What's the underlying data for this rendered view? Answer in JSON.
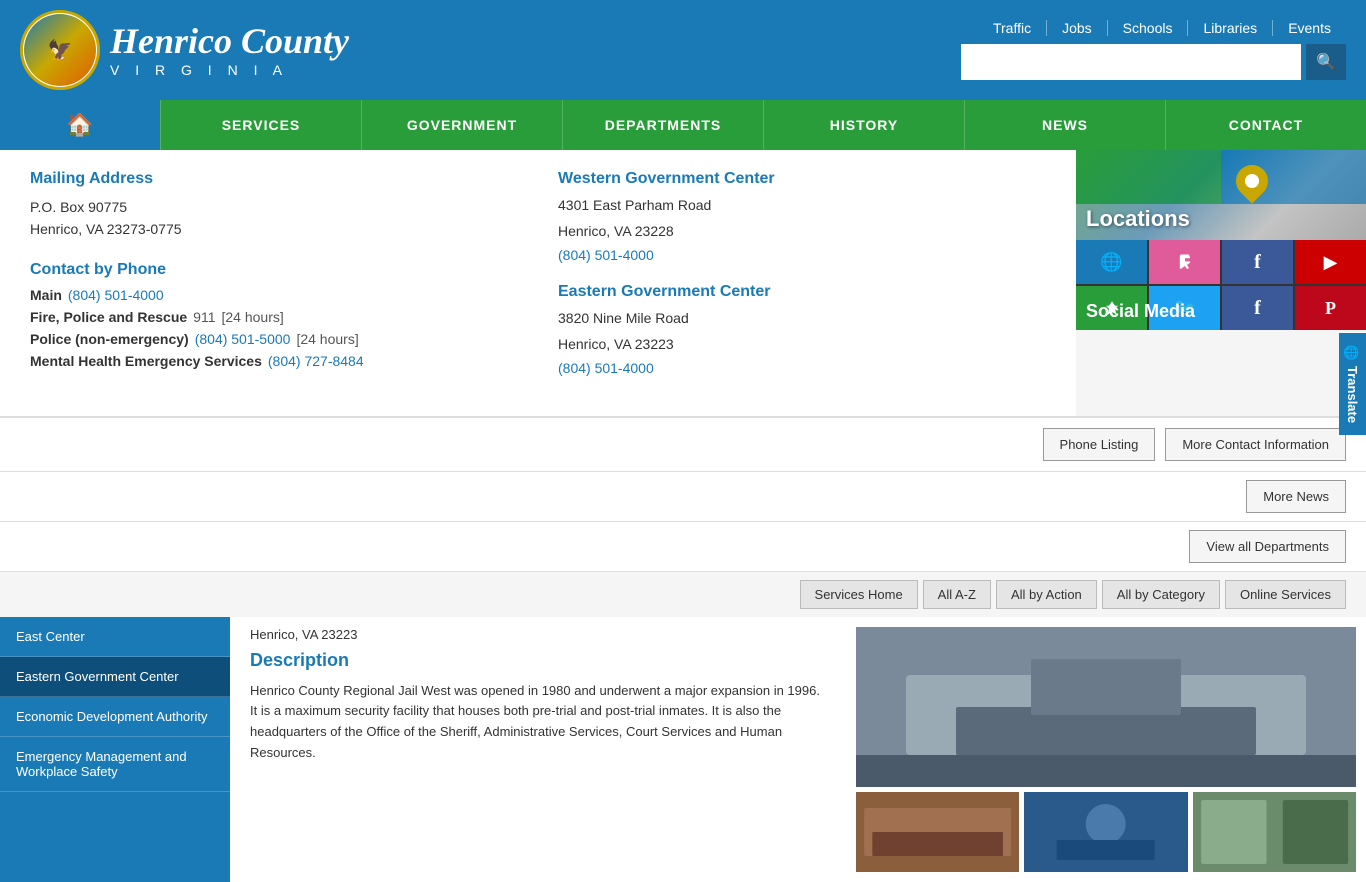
{
  "header": {
    "county_name": "Henrico County",
    "virginia_text": "V I R G I N I A",
    "top_links": [
      {
        "label": "Traffic",
        "id": "traffic"
      },
      {
        "label": "Jobs",
        "id": "jobs"
      },
      {
        "label": "Schools",
        "id": "schools"
      },
      {
        "label": "Libraries",
        "id": "libraries"
      },
      {
        "label": "Events",
        "id": "events"
      }
    ],
    "search_placeholder": ""
  },
  "nav": {
    "items": [
      {
        "label": "SERVICES",
        "id": "services"
      },
      {
        "label": "GOVERNMENT",
        "id": "government"
      },
      {
        "label": "DEPARTMENTS",
        "id": "departments"
      },
      {
        "label": "HISTORY",
        "id": "history"
      },
      {
        "label": "NEWS",
        "id": "news"
      },
      {
        "label": "CONTACT",
        "id": "contact"
      }
    ]
  },
  "contact_panel": {
    "mailing_heading": "Mailing Address",
    "mailing_line1": "P.O. Box 90775",
    "mailing_line2": "Henrico, VA 23273-0775",
    "phone_heading": "Contact by Phone",
    "phone_rows": [
      {
        "label": "Main",
        "number": "(804) 501-4000",
        "note": ""
      },
      {
        "label": "Fire, Police and Rescue",
        "number": "911",
        "note": "[24 hours]"
      },
      {
        "label": "Police (non-emergency)",
        "number": "(804) 501-5000",
        "note": "[24 hours]"
      },
      {
        "label": "Mental Health Emergency Services",
        "number": "(804) 727-8484",
        "note": ""
      }
    ],
    "western_heading": "Western Government Center",
    "western_address1": "4301 East Parham Road",
    "western_address2": "Henrico, VA 23228",
    "western_phone": "(804) 501-4000",
    "eastern_heading": "Eastern Government Center",
    "eastern_address1": "3820 Nine Mile Road",
    "eastern_address2": "Henrico, VA 23223",
    "eastern_phone": "(804) 501-4000",
    "sidebar_locations_label": "Locations",
    "sidebar_social_label": "Social Media",
    "btn_phone_listing": "Phone Listing",
    "btn_more_contact": "More Contact Information",
    "btn_more_news": "More News",
    "btn_view_all_depts": "View all Departments"
  },
  "dept_subnav": {
    "items": [
      {
        "label": "Services Home"
      },
      {
        "label": "All A-Z"
      },
      {
        "label": "All by Action"
      },
      {
        "label": "All by Category"
      },
      {
        "label": "Online Services"
      }
    ]
  },
  "left_sidebar": {
    "items": [
      {
        "label": "East Center",
        "active": false
      },
      {
        "label": "Eastern Government Center",
        "active": true
      },
      {
        "label": "Economic Development Authority",
        "active": false
      },
      {
        "label": "Emergency Management and Workplace Safety",
        "active": false
      }
    ]
  },
  "content": {
    "address_line": "Henrico, VA 23223",
    "description_heading": "Description",
    "description_text": "Henrico County Regional Jail West was opened in 1980 and underwent a major expansion in 1996. It is a maximum security facility that houses both pre-trial and post-trial inmates. It is also the headquarters of the Office of the Sheriff, Administrative Services, Court Services and Human Resources."
  },
  "translate": {
    "label": "Translate"
  }
}
